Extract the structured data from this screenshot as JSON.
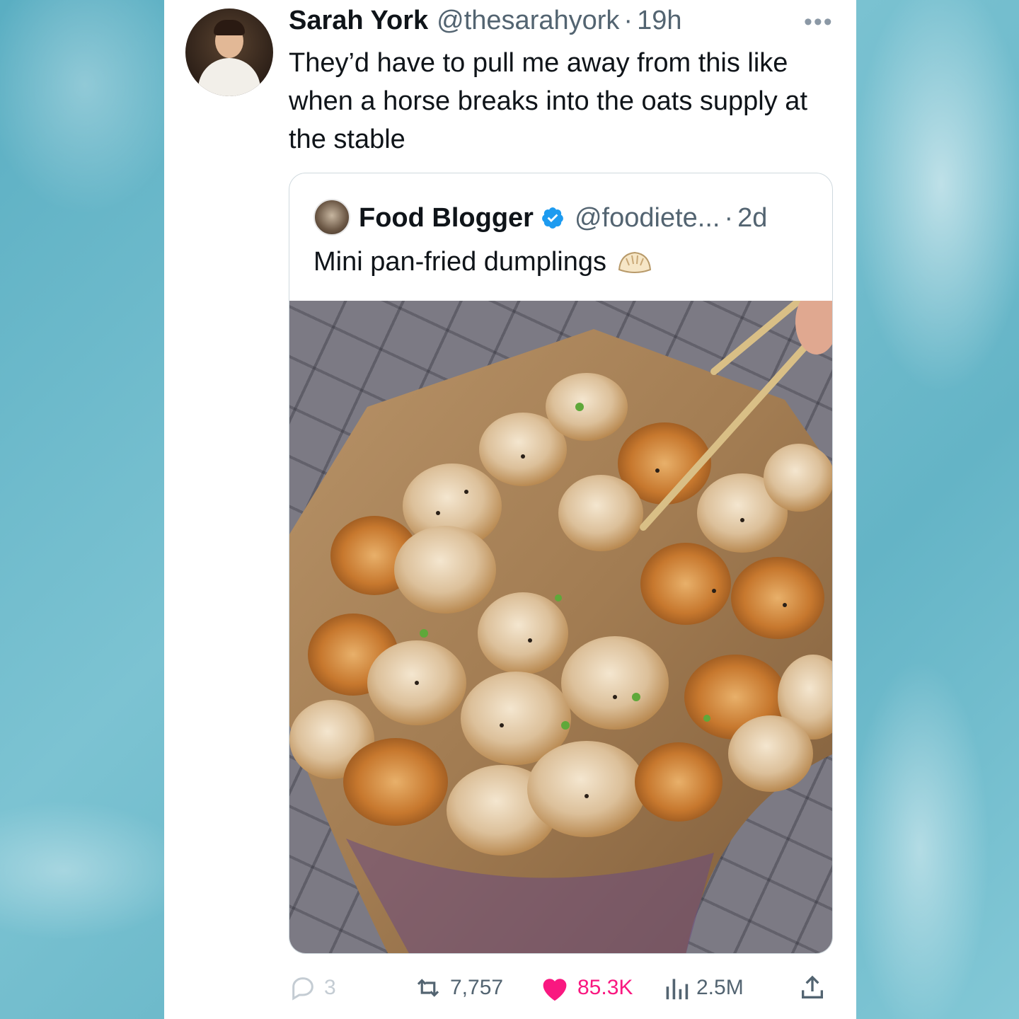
{
  "tweet": {
    "author_name": "Sarah York",
    "handle": "@thesarahyork",
    "separator": "·",
    "time": "19h",
    "more_icon": "more-horizontal-icon",
    "text": "They’d have to pull me away from this like when a horse breaks into the oats supply at the stable"
  },
  "quoted": {
    "author_name": "Food Blogger",
    "verified": true,
    "handle": "@foodiete...",
    "separator": "·",
    "time": "2d",
    "text": "Mini pan-fried dumplings",
    "emoji": "dumpling-emoji"
  },
  "actions": {
    "replies": "3",
    "retweets": "7,757",
    "likes": "85.3K",
    "views": "2.5M",
    "icons": [
      "reply-icon",
      "retweet-icon",
      "heart-icon",
      "views-icon",
      "share-icon"
    ]
  },
  "colors": {
    "like": "#f91880",
    "verified": "#1d9bf0",
    "text": "#0f1419",
    "secondary": "#536471",
    "background": "#6fb8c8"
  }
}
